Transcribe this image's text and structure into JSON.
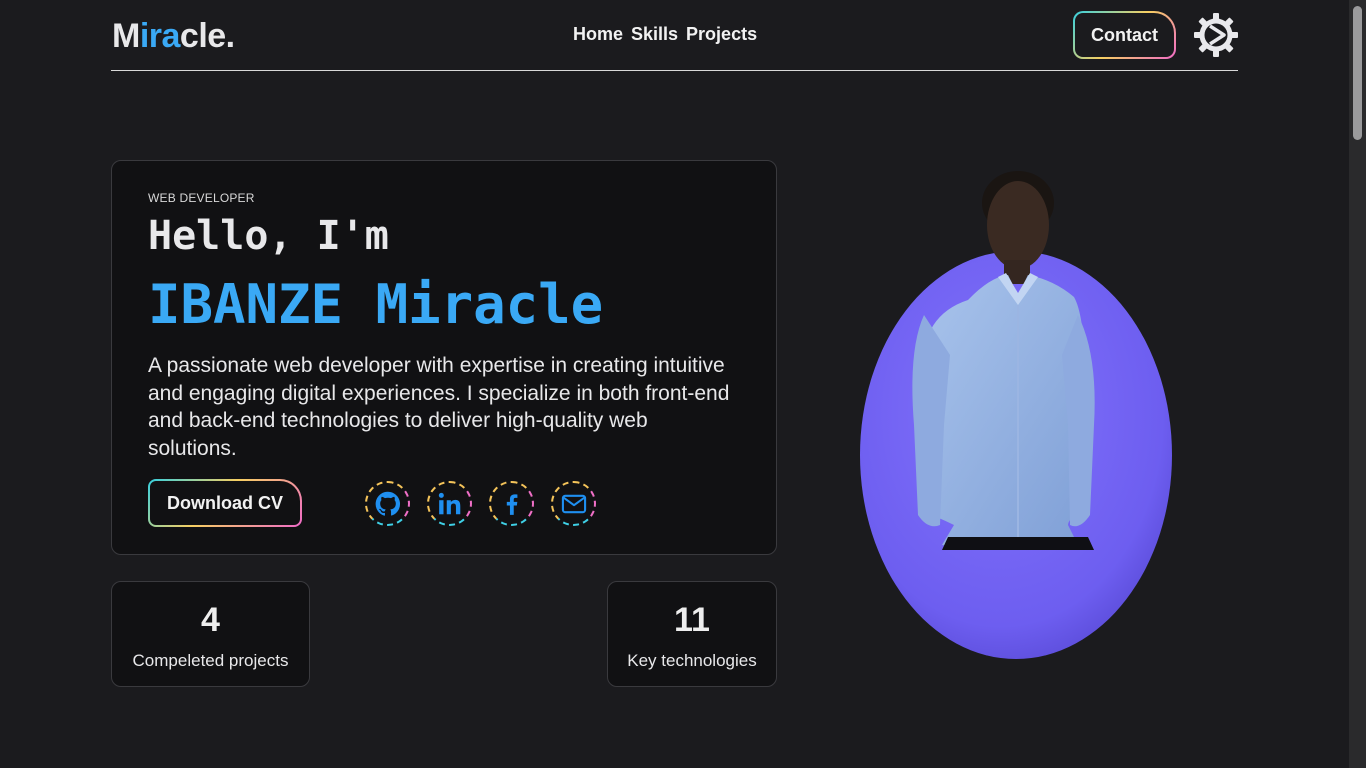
{
  "header": {
    "logo": {
      "part1": "M",
      "part2": "ira",
      "part3": "cle."
    },
    "nav": [
      {
        "label": "Home"
      },
      {
        "label": "Skills"
      },
      {
        "label": "Projects"
      }
    ],
    "contact_label": "Contact",
    "settings_icon": "gear-icon"
  },
  "hero": {
    "role": "WEB DEVELOPER",
    "greeting": "Hello, I'm",
    "name": "IBANZE Miracle",
    "bio": "A passionate web developer with expertise in creating intuitive and engaging digital experiences. I specialize in both front-end and back-end technologies to deliver high-quality web solutions.",
    "cv_label": "Download CV",
    "socials": [
      {
        "icon": "github-icon"
      },
      {
        "icon": "linkedin-icon"
      },
      {
        "icon": "facebook-icon"
      },
      {
        "icon": "mail-icon"
      }
    ]
  },
  "stats": [
    {
      "value": "4",
      "label": "Compeleted projects"
    },
    {
      "value": "11",
      "label": "Key technologies"
    }
  ],
  "colors": {
    "background": "#1b1b1e",
    "accent": "#3aa9f5",
    "card": "#111113",
    "portrait_blob": "#7262f0"
  }
}
